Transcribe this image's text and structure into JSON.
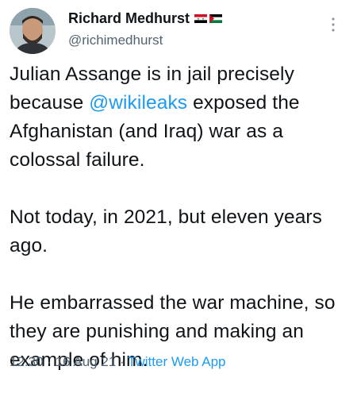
{
  "author": {
    "display_name": "Richard Medhurst",
    "handle": "@richimedhurst",
    "flags": [
      "syria-flag",
      "palestine-flag"
    ]
  },
  "tweet": {
    "para1_before_mention": "Julian Assange is in jail precisely because ",
    "mention": "@wikileaks",
    "para1_after_mention": "  exposed the Afghanistan (and Iraq) war as a colossal failure.",
    "para2": "Not today, in 2021, but eleven years ago.",
    "para3": "He embarrassed the war machine, so they are punishing and making an example of him."
  },
  "meta": {
    "time": "12:30",
    "separator1": " · ",
    "date": "16 Aug 21",
    "separator2": " · ",
    "source": "Twitter Web App"
  },
  "colors": {
    "link": "#1d9bf0",
    "secondary_text": "#536471",
    "primary_text": "#0f1419"
  },
  "icons": {
    "more": "more-options-icon"
  }
}
